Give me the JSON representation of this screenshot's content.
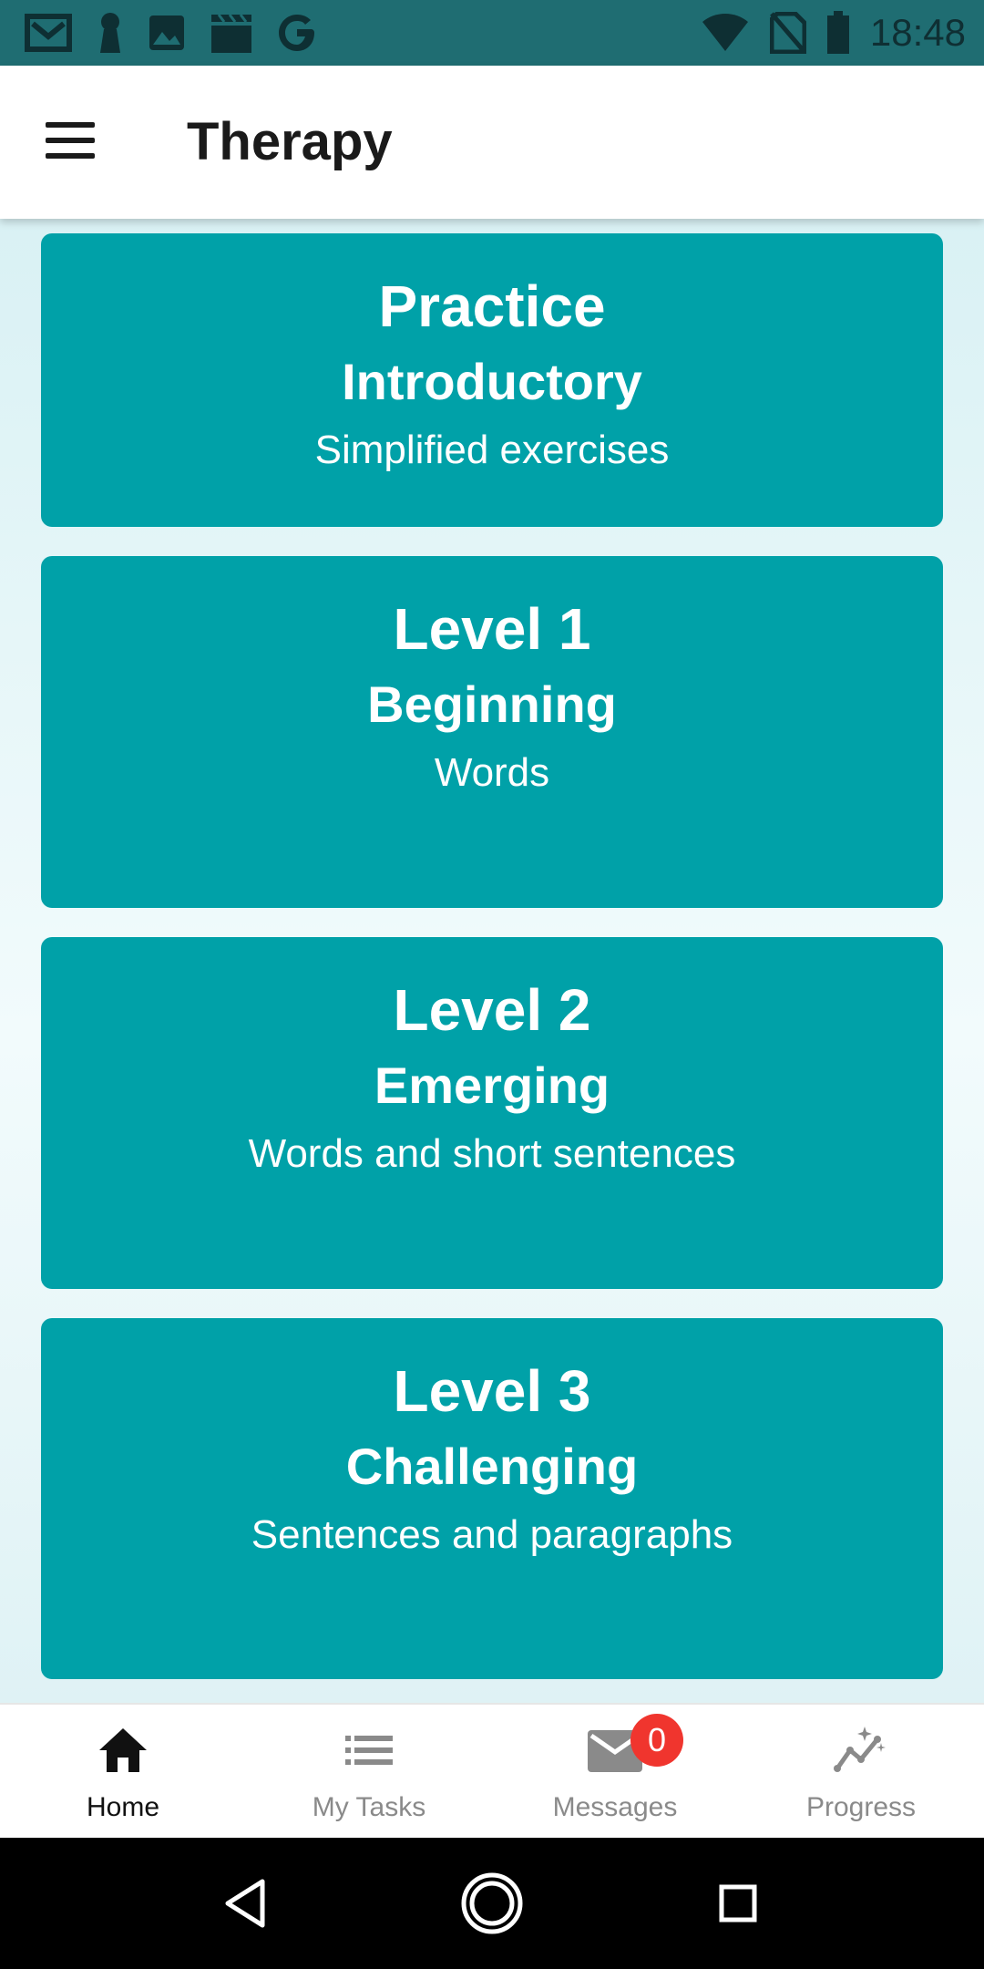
{
  "status_bar": {
    "time": "18:48",
    "left_icons": [
      "gmail-icon",
      "keyhole-icon",
      "image-icon",
      "clapper-icon",
      "google-icon"
    ],
    "right_icons": [
      "wifi-icon",
      "no-sim-icon",
      "battery-icon"
    ]
  },
  "app_bar": {
    "title": "Therapy",
    "menu_icon": "menu-icon"
  },
  "cards": [
    {
      "title": "Practice",
      "subtitle": "Introductory",
      "description": "Simplified exercises"
    },
    {
      "title": "Level 1",
      "subtitle": "Beginning",
      "description": "Words"
    },
    {
      "title": "Level 2",
      "subtitle": "Emerging",
      "description": "Words and short sentences"
    },
    {
      "title": "Level 3",
      "subtitle": "Challenging",
      "description": "Sentences and paragraphs"
    }
  ],
  "bottom_nav": {
    "items": [
      {
        "label": "Home",
        "icon": "home-icon",
        "active": true
      },
      {
        "label": "My Tasks",
        "icon": "list-icon",
        "active": false
      },
      {
        "label": "Messages",
        "icon": "mail-icon",
        "active": false,
        "badge": "0"
      },
      {
        "label": "Progress",
        "icon": "progress-chart-icon",
        "active": false
      }
    ]
  },
  "system_nav": [
    "back-icon",
    "home-circle-icon",
    "recents-icon"
  ],
  "colors": {
    "status_bar": "#1f6d72",
    "card": "#00a1a8",
    "badge": "#f0352e",
    "background_top": "#d9f1f4"
  }
}
